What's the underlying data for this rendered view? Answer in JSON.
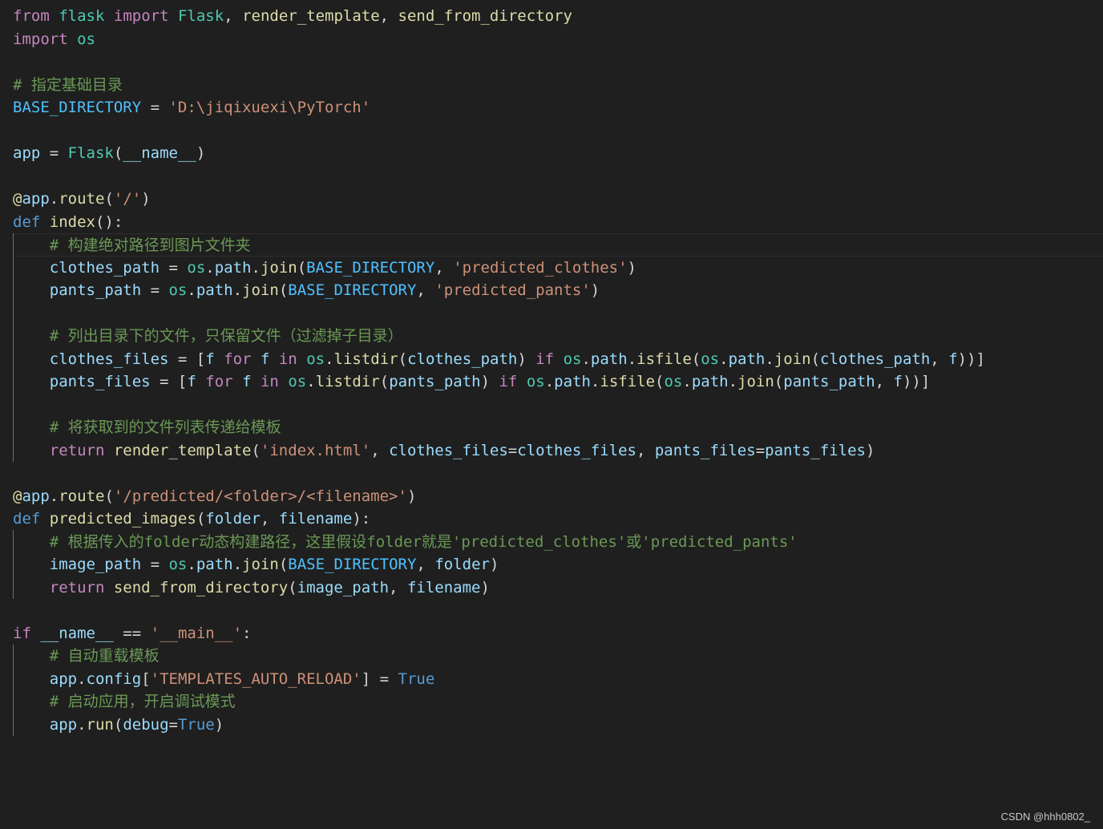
{
  "colors": {
    "background": "#1f1f1f",
    "keyword_control": "#c586c0",
    "keyword": "#569cd6",
    "module": "#4ec9b0",
    "function": "#dcdcaa",
    "variable": "#9cdcfe",
    "constant": "#4fc1ff",
    "string": "#ce9178",
    "comment": "#6a9955",
    "plain": "#d4d4d4",
    "operator": "#d4d4d4"
  },
  "code": {
    "lines": [
      [
        {
          "t": "from",
          "c": "keyword_control"
        },
        {
          "t": " ",
          "c": "plain"
        },
        {
          "t": "flask",
          "c": "module"
        },
        {
          "t": " ",
          "c": "plain"
        },
        {
          "t": "import",
          "c": "keyword_control"
        },
        {
          "t": " ",
          "c": "plain"
        },
        {
          "t": "Flask",
          "c": "module"
        },
        {
          "t": ", ",
          "c": "plain"
        },
        {
          "t": "render_template",
          "c": "function"
        },
        {
          "t": ", ",
          "c": "plain"
        },
        {
          "t": "send_from_directory",
          "c": "function"
        }
      ],
      [
        {
          "t": "import",
          "c": "keyword_control"
        },
        {
          "t": " ",
          "c": "plain"
        },
        {
          "t": "os",
          "c": "module"
        }
      ],
      [],
      [
        {
          "t": "# 指定基础目录",
          "c": "comment"
        }
      ],
      [
        {
          "t": "BASE_DIRECTORY",
          "c": "constant"
        },
        {
          "t": " = ",
          "c": "plain"
        },
        {
          "t": "'D:\\jiqixuexi\\PyTorch'",
          "c": "string"
        }
      ],
      [],
      [
        {
          "t": "app",
          "c": "variable"
        },
        {
          "t": " = ",
          "c": "plain"
        },
        {
          "t": "Flask",
          "c": "module"
        },
        {
          "t": "(",
          "c": "plain"
        },
        {
          "t": "__name__",
          "c": "variable"
        },
        {
          "t": ")",
          "c": "plain"
        }
      ],
      [],
      [
        {
          "t": "@",
          "c": "function"
        },
        {
          "t": "app",
          "c": "variable"
        },
        {
          "t": ".",
          "c": "plain"
        },
        {
          "t": "route",
          "c": "function"
        },
        {
          "t": "(",
          "c": "plain"
        },
        {
          "t": "'/'",
          "c": "string"
        },
        {
          "t": ")",
          "c": "plain"
        }
      ],
      [
        {
          "t": "def",
          "c": "keyword"
        },
        {
          "t": " ",
          "c": "plain"
        },
        {
          "t": "index",
          "c": "function"
        },
        {
          "t": "():",
          "c": "plain"
        }
      ],
      [
        {
          "t": "    ",
          "c": "plain"
        },
        {
          "t": "# 构建绝对路径到图片文件夹",
          "c": "comment"
        }
      ],
      [
        {
          "t": "    ",
          "c": "plain"
        },
        {
          "t": "clothes_path",
          "c": "variable"
        },
        {
          "t": " = ",
          "c": "plain"
        },
        {
          "t": "os",
          "c": "module"
        },
        {
          "t": ".",
          "c": "plain"
        },
        {
          "t": "path",
          "c": "variable"
        },
        {
          "t": ".",
          "c": "plain"
        },
        {
          "t": "join",
          "c": "function"
        },
        {
          "t": "(",
          "c": "plain"
        },
        {
          "t": "BASE_DIRECTORY",
          "c": "constant"
        },
        {
          "t": ", ",
          "c": "plain"
        },
        {
          "t": "'predicted_clothes'",
          "c": "string"
        },
        {
          "t": ")",
          "c": "plain"
        }
      ],
      [
        {
          "t": "    ",
          "c": "plain"
        },
        {
          "t": "pants_path",
          "c": "variable"
        },
        {
          "t": " = ",
          "c": "plain"
        },
        {
          "t": "os",
          "c": "module"
        },
        {
          "t": ".",
          "c": "plain"
        },
        {
          "t": "path",
          "c": "variable"
        },
        {
          "t": ".",
          "c": "plain"
        },
        {
          "t": "join",
          "c": "function"
        },
        {
          "t": "(",
          "c": "plain"
        },
        {
          "t": "BASE_DIRECTORY",
          "c": "constant"
        },
        {
          "t": ", ",
          "c": "plain"
        },
        {
          "t": "'predicted_pants'",
          "c": "string"
        },
        {
          "t": ")",
          "c": "plain"
        }
      ],
      [],
      [
        {
          "t": "    ",
          "c": "plain"
        },
        {
          "t": "# 列出目录下的文件，只保留文件（过滤掉子目录）",
          "c": "comment"
        }
      ],
      [
        {
          "t": "    ",
          "c": "plain"
        },
        {
          "t": "clothes_files",
          "c": "variable"
        },
        {
          "t": " = [",
          "c": "plain"
        },
        {
          "t": "f",
          "c": "variable"
        },
        {
          "t": " ",
          "c": "plain"
        },
        {
          "t": "for",
          "c": "keyword_control"
        },
        {
          "t": " ",
          "c": "plain"
        },
        {
          "t": "f",
          "c": "variable"
        },
        {
          "t": " ",
          "c": "plain"
        },
        {
          "t": "in",
          "c": "keyword_control"
        },
        {
          "t": " ",
          "c": "plain"
        },
        {
          "t": "os",
          "c": "module"
        },
        {
          "t": ".",
          "c": "plain"
        },
        {
          "t": "listdir",
          "c": "function"
        },
        {
          "t": "(",
          "c": "plain"
        },
        {
          "t": "clothes_path",
          "c": "variable"
        },
        {
          "t": ") ",
          "c": "plain"
        },
        {
          "t": "if",
          "c": "keyword_control"
        },
        {
          "t": " ",
          "c": "plain"
        },
        {
          "t": "os",
          "c": "module"
        },
        {
          "t": ".",
          "c": "plain"
        },
        {
          "t": "path",
          "c": "variable"
        },
        {
          "t": ".",
          "c": "plain"
        },
        {
          "t": "isfile",
          "c": "function"
        },
        {
          "t": "(",
          "c": "plain"
        },
        {
          "t": "os",
          "c": "module"
        },
        {
          "t": ".",
          "c": "plain"
        },
        {
          "t": "path",
          "c": "variable"
        },
        {
          "t": ".",
          "c": "plain"
        },
        {
          "t": "join",
          "c": "function"
        },
        {
          "t": "(",
          "c": "plain"
        },
        {
          "t": "clothes_path",
          "c": "variable"
        },
        {
          "t": ", ",
          "c": "plain"
        },
        {
          "t": "f",
          "c": "variable"
        },
        {
          "t": "))]",
          "c": "plain"
        }
      ],
      [
        {
          "t": "    ",
          "c": "plain"
        },
        {
          "t": "pants_files",
          "c": "variable"
        },
        {
          "t": " = [",
          "c": "plain"
        },
        {
          "t": "f",
          "c": "variable"
        },
        {
          "t": " ",
          "c": "plain"
        },
        {
          "t": "for",
          "c": "keyword_control"
        },
        {
          "t": " ",
          "c": "plain"
        },
        {
          "t": "f",
          "c": "variable"
        },
        {
          "t": " ",
          "c": "plain"
        },
        {
          "t": "in",
          "c": "keyword_control"
        },
        {
          "t": " ",
          "c": "plain"
        },
        {
          "t": "os",
          "c": "module"
        },
        {
          "t": ".",
          "c": "plain"
        },
        {
          "t": "listdir",
          "c": "function"
        },
        {
          "t": "(",
          "c": "plain"
        },
        {
          "t": "pants_path",
          "c": "variable"
        },
        {
          "t": ") ",
          "c": "plain"
        },
        {
          "t": "if",
          "c": "keyword_control"
        },
        {
          "t": " ",
          "c": "plain"
        },
        {
          "t": "os",
          "c": "module"
        },
        {
          "t": ".",
          "c": "plain"
        },
        {
          "t": "path",
          "c": "variable"
        },
        {
          "t": ".",
          "c": "plain"
        },
        {
          "t": "isfile",
          "c": "function"
        },
        {
          "t": "(",
          "c": "plain"
        },
        {
          "t": "os",
          "c": "module"
        },
        {
          "t": ".",
          "c": "plain"
        },
        {
          "t": "path",
          "c": "variable"
        },
        {
          "t": ".",
          "c": "plain"
        },
        {
          "t": "join",
          "c": "function"
        },
        {
          "t": "(",
          "c": "plain"
        },
        {
          "t": "pants_path",
          "c": "variable"
        },
        {
          "t": ", ",
          "c": "plain"
        },
        {
          "t": "f",
          "c": "variable"
        },
        {
          "t": "))]",
          "c": "plain"
        }
      ],
      [],
      [
        {
          "t": "    ",
          "c": "plain"
        },
        {
          "t": "# 将获取到的文件列表传递给模板",
          "c": "comment"
        }
      ],
      [
        {
          "t": "    ",
          "c": "plain"
        },
        {
          "t": "return",
          "c": "keyword_control"
        },
        {
          "t": " ",
          "c": "plain"
        },
        {
          "t": "render_template",
          "c": "function"
        },
        {
          "t": "(",
          "c": "plain"
        },
        {
          "t": "'index.html'",
          "c": "string"
        },
        {
          "t": ", ",
          "c": "plain"
        },
        {
          "t": "clothes_files",
          "c": "variable"
        },
        {
          "t": "=",
          "c": "plain"
        },
        {
          "t": "clothes_files",
          "c": "variable"
        },
        {
          "t": ", ",
          "c": "plain"
        },
        {
          "t": "pants_files",
          "c": "variable"
        },
        {
          "t": "=",
          "c": "plain"
        },
        {
          "t": "pants_files",
          "c": "variable"
        },
        {
          "t": ")",
          "c": "plain"
        }
      ],
      [],
      [
        {
          "t": "@",
          "c": "function"
        },
        {
          "t": "app",
          "c": "variable"
        },
        {
          "t": ".",
          "c": "plain"
        },
        {
          "t": "route",
          "c": "function"
        },
        {
          "t": "(",
          "c": "plain"
        },
        {
          "t": "'/predicted/<folder>/<filename>'",
          "c": "string"
        },
        {
          "t": ")",
          "c": "plain"
        }
      ],
      [
        {
          "t": "def",
          "c": "keyword"
        },
        {
          "t": " ",
          "c": "plain"
        },
        {
          "t": "predicted_images",
          "c": "function"
        },
        {
          "t": "(",
          "c": "plain"
        },
        {
          "t": "folder",
          "c": "variable"
        },
        {
          "t": ", ",
          "c": "plain"
        },
        {
          "t": "filename",
          "c": "variable"
        },
        {
          "t": "):",
          "c": "plain"
        }
      ],
      [
        {
          "t": "    ",
          "c": "plain"
        },
        {
          "t": "# 根据传入的folder动态构建路径，这里假设folder就是'predicted_clothes'或'predicted_pants'",
          "c": "comment"
        }
      ],
      [
        {
          "t": "    ",
          "c": "plain"
        },
        {
          "t": "image_path",
          "c": "variable"
        },
        {
          "t": " = ",
          "c": "plain"
        },
        {
          "t": "os",
          "c": "module"
        },
        {
          "t": ".",
          "c": "plain"
        },
        {
          "t": "path",
          "c": "variable"
        },
        {
          "t": ".",
          "c": "plain"
        },
        {
          "t": "join",
          "c": "function"
        },
        {
          "t": "(",
          "c": "plain"
        },
        {
          "t": "BASE_DIRECTORY",
          "c": "constant"
        },
        {
          "t": ", ",
          "c": "plain"
        },
        {
          "t": "folder",
          "c": "variable"
        },
        {
          "t": ")",
          "c": "plain"
        }
      ],
      [
        {
          "t": "    ",
          "c": "plain"
        },
        {
          "t": "return",
          "c": "keyword_control"
        },
        {
          "t": " ",
          "c": "plain"
        },
        {
          "t": "send_from_directory",
          "c": "function"
        },
        {
          "t": "(",
          "c": "plain"
        },
        {
          "t": "image_path",
          "c": "variable"
        },
        {
          "t": ", ",
          "c": "plain"
        },
        {
          "t": "filename",
          "c": "variable"
        },
        {
          "t": ")",
          "c": "plain"
        }
      ],
      [],
      [
        {
          "t": "if",
          "c": "keyword_control"
        },
        {
          "t": " ",
          "c": "plain"
        },
        {
          "t": "__name__",
          "c": "variable"
        },
        {
          "t": " == ",
          "c": "plain"
        },
        {
          "t": "'__main__'",
          "c": "string"
        },
        {
          "t": ":",
          "c": "plain"
        }
      ],
      [
        {
          "t": "    ",
          "c": "plain"
        },
        {
          "t": "# 自动重载模板",
          "c": "comment"
        }
      ],
      [
        {
          "t": "    ",
          "c": "plain"
        },
        {
          "t": "app",
          "c": "variable"
        },
        {
          "t": ".",
          "c": "plain"
        },
        {
          "t": "config",
          "c": "variable"
        },
        {
          "t": "[",
          "c": "plain"
        },
        {
          "t": "'TEMPLATES_AUTO_RELOAD'",
          "c": "string"
        },
        {
          "t": "] = ",
          "c": "plain"
        },
        {
          "t": "True",
          "c": "keyword"
        }
      ],
      [
        {
          "t": "    ",
          "c": "plain"
        },
        {
          "t": "# 启动应用，开启调试模式",
          "c": "comment"
        }
      ],
      [
        {
          "t": "    ",
          "c": "plain"
        },
        {
          "t": "app",
          "c": "variable"
        },
        {
          "t": ".",
          "c": "plain"
        },
        {
          "t": "run",
          "c": "function"
        },
        {
          "t": "(",
          "c": "plain"
        },
        {
          "t": "debug",
          "c": "variable"
        },
        {
          "t": "=",
          "c": "plain"
        },
        {
          "t": "True",
          "c": "keyword"
        },
        {
          "t": ")",
          "c": "plain"
        }
      ]
    ]
  },
  "watermark": "CSDN @hhh0802_"
}
